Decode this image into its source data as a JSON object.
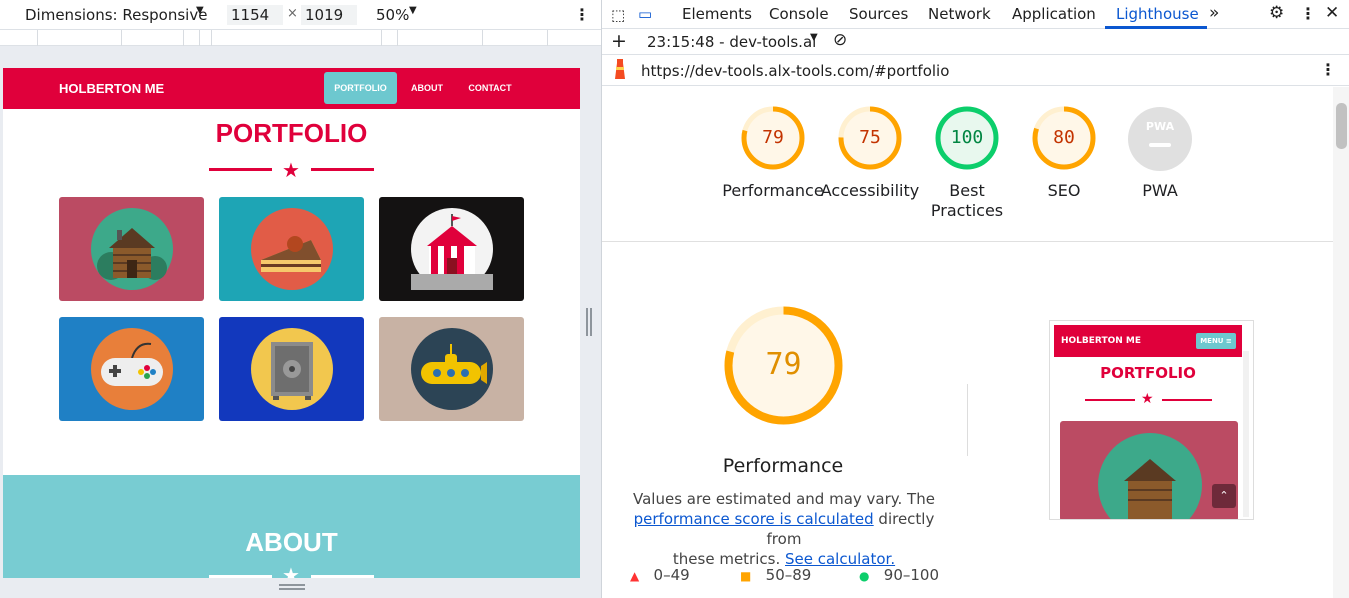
{
  "devbar": {
    "dimensions_label": "Dimensions: Responsive",
    "width": "1154",
    "times": "×",
    "height": "1019",
    "zoom": "50%"
  },
  "site": {
    "brand": "HOLBERTON ME",
    "nav": [
      "PORTFOLIO",
      "ABOUT",
      "CONTACT"
    ],
    "portfolio_title": "PORTFOLIO",
    "about_title": "ABOUT",
    "tile_colors": [
      "#bb4b63",
      "#1ea5b5",
      "#141212",
      "#1f80c5",
      "#1238bd",
      "#c8b2a4"
    ],
    "tile_icons": [
      "cabin-icon",
      "cake-icon",
      "circus-tent-icon",
      "game-controller-icon",
      "safe-icon",
      "submarine-icon"
    ]
  },
  "devtools": {
    "tabs": [
      "Elements",
      "Console",
      "Sources",
      "Network",
      "Application",
      "Lighthouse"
    ],
    "active_tab": "Lighthouse",
    "report_time": "23:15:48 - dev-tools.al",
    "url": "https://dev-tools.alx-tools.com/#portfolio"
  },
  "scores": [
    {
      "label": "Performance",
      "value": "79",
      "color": "#ffa400"
    },
    {
      "label": "Accessibility",
      "value": "75",
      "color": "#ffa400"
    },
    {
      "label_line1": "Best",
      "label_line2": "Practices",
      "value": "100",
      "color": "#0cce6b"
    },
    {
      "label": "SEO",
      "value": "80",
      "color": "#ffa400"
    },
    {
      "label": "PWA",
      "value": "PWA",
      "color": "#cccccc"
    }
  ],
  "performance": {
    "value": "79",
    "title": "Performance",
    "desc_text": "Values are estimated and may vary. The",
    "link1": "performance score is calculated",
    "desc_mid": " directly from",
    "desc_end": "these metrics. ",
    "link2": "See calculator.",
    "legend": [
      "0–49",
      "50–89",
      "90–100"
    ]
  },
  "thumbnail": {
    "brand": "HOLBERTON ME",
    "menu": "MENU ≡",
    "title": "PORTFOLIO"
  }
}
